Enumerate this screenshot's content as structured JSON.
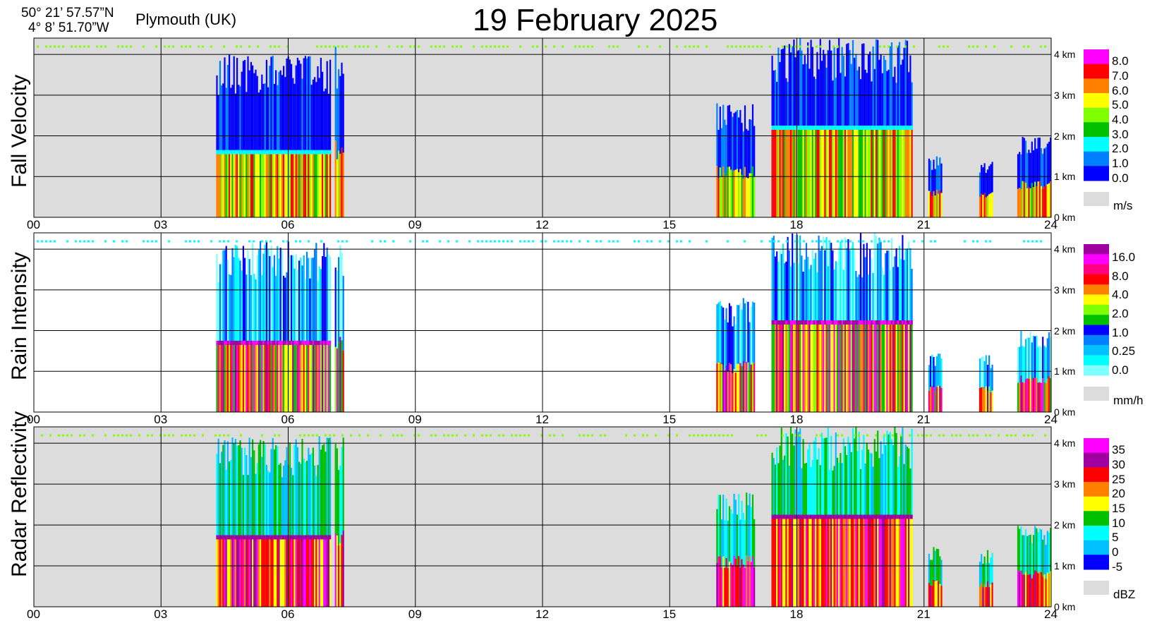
{
  "header": {
    "lat": "50° 21’ 57.57”N",
    "lon": "4°  8’ 51.70”W",
    "location": "Plymouth (UK)",
    "title": "19 February  2025"
  },
  "x_ticks": [
    "00",
    "03",
    "06",
    "09",
    "12",
    "15",
    "18",
    "21",
    "24"
  ],
  "y_ticks": [
    "0 km",
    "1 km",
    "2 km",
    "3 km",
    "4 km"
  ],
  "panels": [
    {
      "title": "Fall Velocity",
      "background": "#dcdcdc",
      "unit": "m/s",
      "legend_labels": [
        "8.0",
        "7.0",
        "6.0",
        "5.0",
        "4.0",
        "3.0",
        "2.0",
        "1.0",
        "0.0"
      ],
      "legend_colors": [
        "#ff00ff",
        "#ff0000",
        "#ff8000",
        "#ffff00",
        "#80ff00",
        "#00c000",
        "#00ffff",
        "#0080ff",
        "#0000ff"
      ]
    },
    {
      "title": "Rain Intensity",
      "background": "#ffffff",
      "unit": "mm/h",
      "legend_labels": [
        "16.0",
        "8.0",
        "4.0",
        "2.0",
        "1.0",
        "0.25",
        "0.0"
      ],
      "legend_colors": [
        "#a000a0",
        "#ff00ff",
        "#ff0080",
        "#ff0000",
        "#ff8000",
        "#ffff00",
        "#80ff00",
        "#00c000",
        "#0000ff",
        "#0080ff",
        "#00c0ff",
        "#00ffff",
        "#80ffff"
      ]
    },
    {
      "title": "Radar Reflectivity",
      "background": "#dcdcdc",
      "unit": "dBZ",
      "legend_labels": [
        "35",
        "30",
        "25",
        "20",
        "15",
        "10",
        "5",
        "0",
        "-5"
      ],
      "legend_colors": [
        "#ff00ff",
        "#a000a0",
        "#ff0000",
        "#ff8000",
        "#ffff00",
        "#00c000",
        "#00ffff",
        "#00c0ff",
        "#0000ff"
      ]
    }
  ],
  "chart_data": [
    {
      "type": "heatmap",
      "title": "Fall Velocity",
      "x_range_hours": [
        0,
        24
      ],
      "y_range_km": [
        0,
        4.4
      ],
      "color_scale_label": "m/s",
      "color_scale_ticks": [
        0.0,
        1.0,
        2.0,
        3.0,
        4.0,
        5.0,
        6.0,
        7.0,
        8.0
      ],
      "precipitation_events": [
        {
          "start_h": 4.3,
          "end_h": 7.0,
          "top_km": 4.0,
          "melting_layer_km": 1.6
        },
        {
          "start_h": 7.1,
          "end_h": 7.3,
          "top_km": 4.2
        },
        {
          "start_h": 16.1,
          "end_h": 17.0,
          "top_km": 2.8
        },
        {
          "start_h": 17.4,
          "end_h": 20.7,
          "top_km": 4.4,
          "melting_layer_km": 2.2
        },
        {
          "start_h": 21.1,
          "end_h": 21.4,
          "top_km": 1.5
        },
        {
          "start_h": 22.3,
          "end_h": 22.6,
          "top_km": 1.4
        },
        {
          "start_h": 23.2,
          "end_h": 24.0,
          "top_km": 2.0
        }
      ]
    },
    {
      "type": "heatmap",
      "title": "Rain Intensity",
      "x_range_hours": [
        0,
        24
      ],
      "y_range_km": [
        0,
        4.4
      ],
      "color_scale_label": "mm/h",
      "color_scale_ticks": [
        0.0,
        0.25,
        1.0,
        2.0,
        4.0,
        8.0,
        16.0
      ],
      "precipitation_events": [
        {
          "start_h": 4.3,
          "end_h": 7.0,
          "top_km": 4.2,
          "bright_band_km": 1.7
        },
        {
          "start_h": 7.1,
          "end_h": 7.3,
          "top_km": 4.2
        },
        {
          "start_h": 16.1,
          "end_h": 17.0,
          "top_km": 2.8
        },
        {
          "start_h": 17.4,
          "end_h": 20.7,
          "top_km": 4.4,
          "bright_band_km": 2.2
        },
        {
          "start_h": 21.1,
          "end_h": 21.4,
          "top_km": 1.5
        },
        {
          "start_h": 22.3,
          "end_h": 22.6,
          "top_km": 1.4
        },
        {
          "start_h": 23.2,
          "end_h": 24.0,
          "top_km": 2.0
        }
      ]
    },
    {
      "type": "heatmap",
      "title": "Radar Reflectivity",
      "x_range_hours": [
        0,
        24
      ],
      "y_range_km": [
        0,
        4.4
      ],
      "color_scale_label": "dBZ",
      "color_scale_ticks": [
        -5,
        0,
        5,
        10,
        15,
        20,
        25,
        30,
        35
      ],
      "precipitation_events": [
        {
          "start_h": 4.3,
          "end_h": 7.0,
          "top_km": 4.2,
          "bright_band_km": 1.7
        },
        {
          "start_h": 7.1,
          "end_h": 7.3,
          "top_km": 4.2
        },
        {
          "start_h": 16.1,
          "end_h": 17.0,
          "top_km": 2.8
        },
        {
          "start_h": 17.4,
          "end_h": 20.7,
          "top_km": 4.4,
          "bright_band_km": 2.2
        },
        {
          "start_h": 21.1,
          "end_h": 21.4,
          "top_km": 1.5
        },
        {
          "start_h": 22.3,
          "end_h": 22.6,
          "top_km": 1.4
        },
        {
          "start_h": 23.2,
          "end_h": 24.0,
          "top_km": 2.0
        }
      ]
    }
  ]
}
